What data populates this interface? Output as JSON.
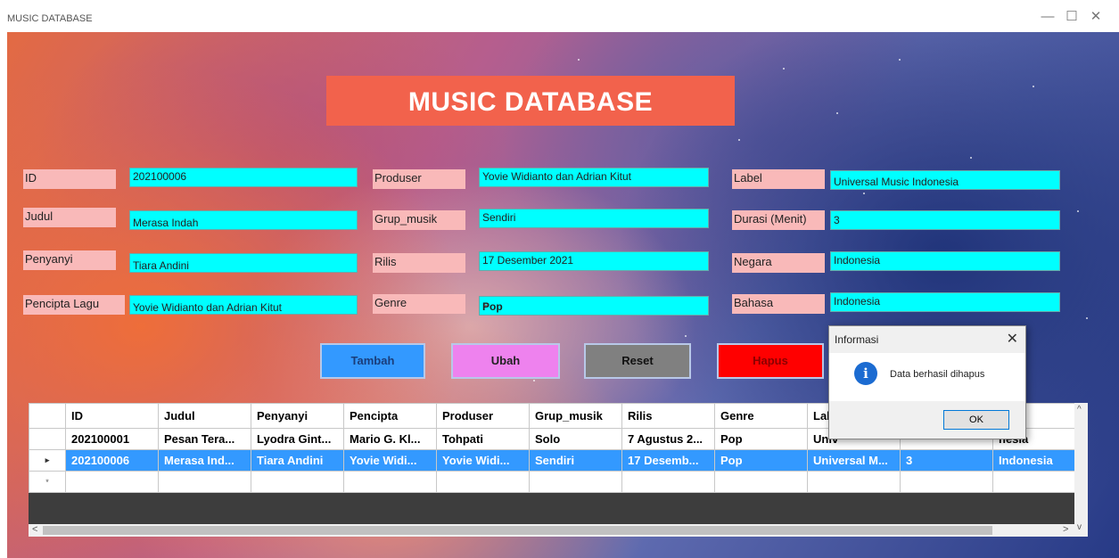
{
  "window": {
    "title": "MUSIC DATABASE",
    "minimize": "—",
    "maximize": "☐",
    "close": "✕"
  },
  "banner": "MUSIC DATABASE",
  "fields": {
    "id": {
      "label": "ID",
      "value": "202100006"
    },
    "judul": {
      "label": "Judul",
      "value": "Merasa Indah"
    },
    "penyanyi": {
      "label": "Penyanyi",
      "value": "Tiara Andini"
    },
    "pencipta": {
      "label": "Pencipta Lagu",
      "value": "Yovie Widianto dan Adrian Kitut"
    },
    "produser": {
      "label": "Produser",
      "value": "Yovie Widianto dan Adrian Kitut"
    },
    "grup": {
      "label": "Grup_musik",
      "value": "Sendiri"
    },
    "rilis": {
      "label": "Rilis",
      "value": "17 Desember 2021"
    },
    "genre": {
      "label": "Genre",
      "value": "Pop"
    },
    "label": {
      "label": "Label",
      "value": "Universal Music Indonesia"
    },
    "durasi": {
      "label": "Durasi (Menit)",
      "value": "3"
    },
    "negara": {
      "label": "Negara",
      "value": "Indonesia"
    },
    "bahasa": {
      "label": "Bahasa",
      "value": "Indonesia"
    }
  },
  "buttons": {
    "tambah": "Tambah",
    "ubah": "Ubah",
    "reset": "Reset",
    "hapus": "Hapus"
  },
  "table": {
    "headers": [
      "ID",
      "Judul",
      "Penyanyi",
      "Pencipta",
      "Produser",
      "Grup_musik",
      "Rilis",
      "Genre",
      "Lab",
      "",
      "ara"
    ],
    "rows": [
      [
        "202100001",
        "Pesan Tera...",
        "Lyodra Gint...",
        "Mario G. Kl...",
        "Tohpati",
        "Solo",
        "7 Agustus 2...",
        "Pop",
        "Univ",
        "",
        "nesia"
      ],
      [
        "202100006",
        "Merasa Ind...",
        "Tiara Andini",
        "Yovie Widi...",
        "Yovie Widi...",
        "Sendiri",
        "17 Desemb...",
        "Pop",
        "Universal M...",
        "3",
        "Indonesia"
      ]
    ],
    "row_markers": [
      "",
      "▸",
      "*"
    ]
  },
  "dialog": {
    "title": "Informasi",
    "close": "✕",
    "icon": "info-icon",
    "icon_glyph": "i",
    "message": "Data berhasil dihapus",
    "ok": "OK"
  },
  "scroll": {
    "up": "^",
    "down": "v",
    "left": "<",
    "right": ">"
  },
  "colors": {
    "label_bg": "#f9b9b9",
    "field_bg": "#00ffff",
    "banner_bg": "#f2624c",
    "tambah_bg": "#3399ff",
    "ubah_bg": "#ee82ee",
    "reset_bg": "#808080",
    "hapus_bg": "#ff0000",
    "selected_row": "#3399ff"
  }
}
